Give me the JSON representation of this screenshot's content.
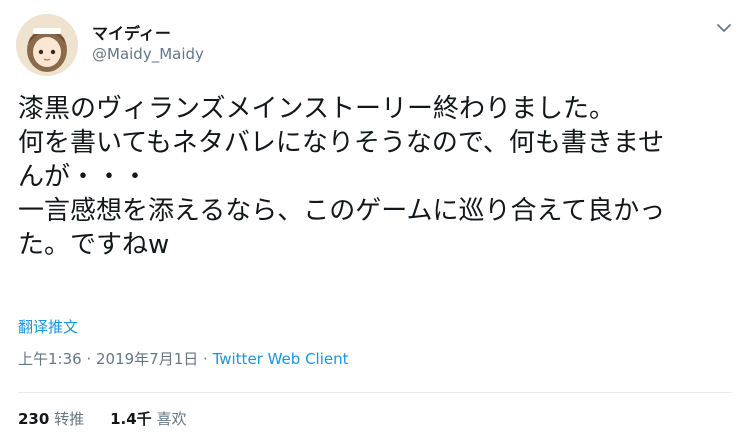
{
  "user": {
    "display_name": "マイディー",
    "handle": "@Maidy_Maidy"
  },
  "tweet": {
    "lines": [
      "漆黒のヴィランズメインストーリー終わりました。",
      "何を書いてもネタバレになりそうなので、何も書きませ",
      "んが・・・",
      "一言感想を添えるなら、このゲームに巡り合えて良かっ",
      "た。ですねw"
    ],
    "translate_label": "翻译推文",
    "timestamp": "上午1:36 · 2019年7月1日",
    "separator": " · ",
    "client": "Twitter Web Client"
  },
  "stats": {
    "retweets_count": "230",
    "retweets_label": "转推",
    "likes_count": "1.4千",
    "likes_label": "喜欢"
  },
  "colors": {
    "link": "#1b95e0",
    "muted": "#657786",
    "text": "#14171a"
  },
  "icons": {
    "caret": "chevron-down-icon",
    "avatar": "avatar"
  }
}
